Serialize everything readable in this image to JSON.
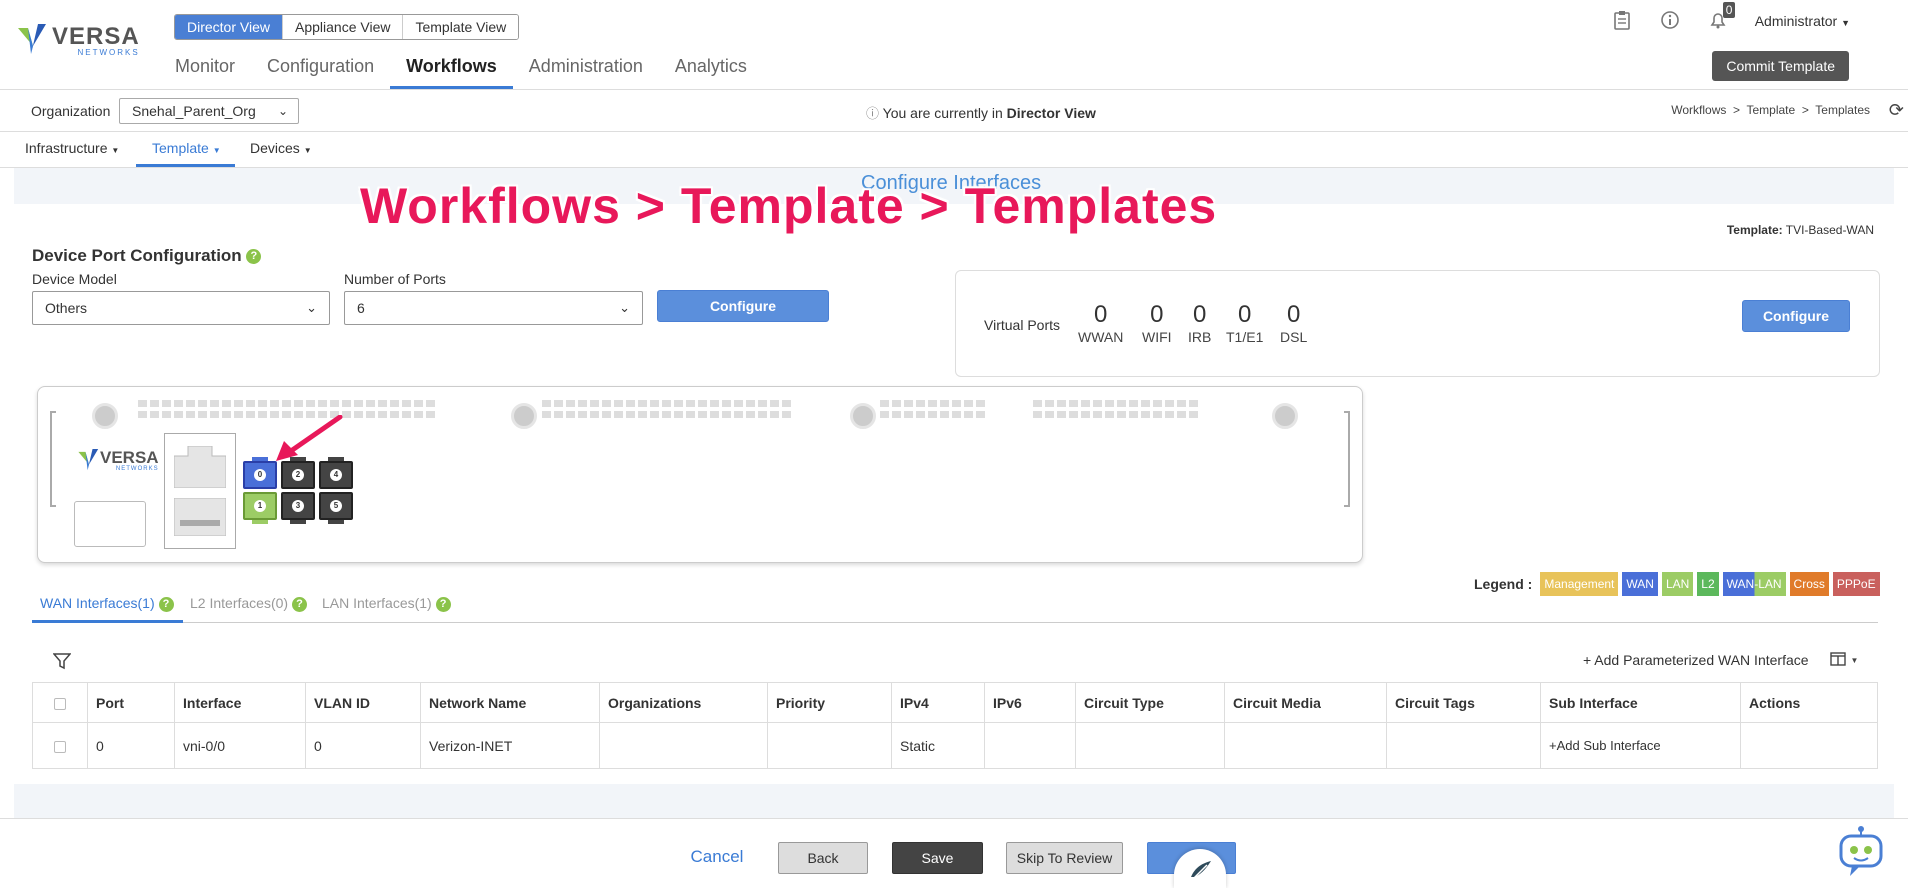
{
  "header": {
    "logo_text": "VERSA",
    "logo_sub": "NETWORKS",
    "views": [
      "Director View",
      "Appliance View",
      "Template View"
    ],
    "nav": [
      "Monitor",
      "Configuration",
      "Workflows",
      "Administration",
      "Analytics"
    ],
    "notification_count": "0",
    "user": "Administrator",
    "commit_label": "Commit Template"
  },
  "orgbar": {
    "org_label": "Organization",
    "org_value": "Snehal_Parent_Org",
    "message_prefix": "You are currently in",
    "message_view": "Director View",
    "breadcrumb": "Workflows  >  Template  >  Templates"
  },
  "subnav": [
    "Infrastructure",
    "Template",
    "Devices"
  ],
  "step_title": "Configure Interfaces",
  "overlay_title": "Workflows > Template > Templates",
  "template_label": "Template:",
  "template_name": "TVI-Based-WAN",
  "dpc": {
    "title": "Device Port Configuration",
    "device_model_label": "Device Model",
    "device_model_value": "Others",
    "ports_label": "Number of Ports",
    "ports_value": "6",
    "configure_label": "Configure"
  },
  "virtual_ports": {
    "label": "Virtual Ports",
    "items": [
      {
        "count": "0",
        "name": "WWAN"
      },
      {
        "count": "0",
        "name": "WIFI"
      },
      {
        "count": "0",
        "name": "IRB"
      },
      {
        "count": "0",
        "name": "T1/E1"
      },
      {
        "count": "0",
        "name": "DSL"
      }
    ],
    "configure_label": "Configure"
  },
  "device_ports": [
    "0",
    "2",
    "4",
    "1",
    "3",
    "5"
  ],
  "legend": {
    "title": "Legend :",
    "items": [
      {
        "label": "Management",
        "color": "#e8c35a"
      },
      {
        "label": "WAN",
        "color": "#4a6fd8"
      },
      {
        "label": "LAN",
        "color": "#9ccc65"
      },
      {
        "label": "L2",
        "color": "#5cb85c"
      },
      {
        "label": "WAN-LAN",
        "color": "#6a7fd8"
      },
      {
        "label": "Cross",
        "color": "#e07b2a"
      },
      {
        "label": "PPPoE",
        "color": "#c9605d"
      }
    ]
  },
  "tabs": [
    "WAN Interfaces(1)",
    "L2 Interfaces(0)",
    "LAN Interfaces(1)"
  ],
  "add_param_label": "+ Add Parameterized WAN Interface",
  "table": {
    "headers": [
      "Port",
      "Interface",
      "VLAN ID",
      "Network Name",
      "Organizations",
      "Priority",
      "IPv4",
      "IPv6",
      "Circuit Type",
      "Circuit Media",
      "Circuit Tags",
      "Sub Interface",
      "Actions"
    ],
    "rows": [
      [
        "0",
        "vni-0/0",
        "0",
        "Verizon-INET",
        "",
        "",
        "Static",
        "",
        "",
        "",
        "",
        "+Add Sub Interface",
        ""
      ]
    ]
  },
  "footer": {
    "cancel": "Cancel",
    "back": "Back",
    "save": "Save",
    "skip": "Skip To Review",
    "next": ""
  }
}
